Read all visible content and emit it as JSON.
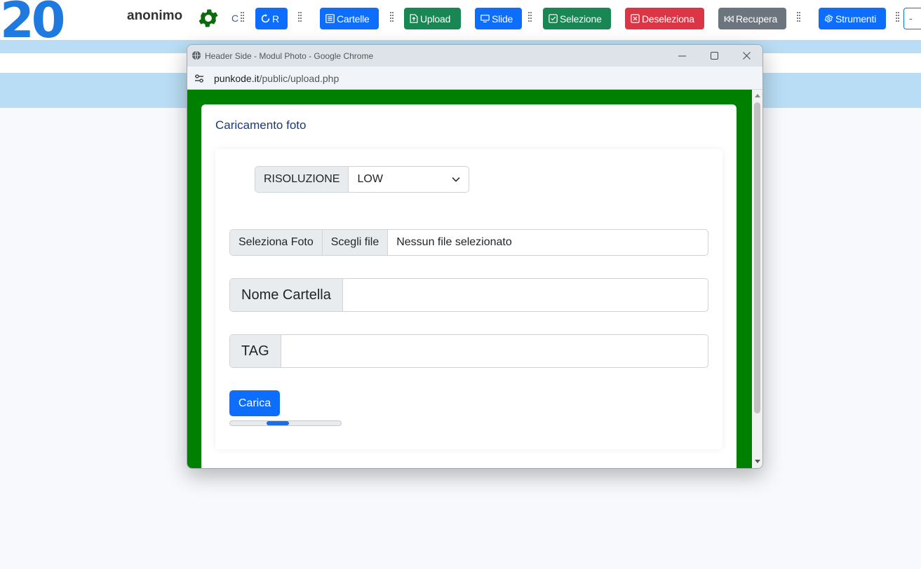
{
  "page": {
    "logo_text": "20",
    "username": "anonimo",
    "c_label": "C",
    "toolbar": {
      "refresh_label": "R",
      "cartelle_label": "Cartelle",
      "upload_label": "Upload",
      "slide_label": "Slide",
      "selezione_label": "Selezione",
      "deseleziona_label": "Deseleziona",
      "recupera_label": "Recupera",
      "strumenti_label": "Strumenti",
      "minus_label": "-"
    },
    "colors": {
      "primary": "#0d6efd",
      "success": "#198754",
      "danger": "#dc3545",
      "secondary": "#6c757d",
      "popup_bg": "#008000",
      "band": "#b9ddf4"
    }
  },
  "window": {
    "title": "Header Side - Modul Photo - Google Chrome",
    "url_host": "punkode.it",
    "url_path": "/public/upload.php"
  },
  "form": {
    "title": "Caricamento foto",
    "resolution_label": "RISOLUZIONE",
    "resolution_value": "LOW",
    "select_photo_label": "Seleziona Foto",
    "choose_file_label": "Scegli file",
    "no_file_text": "Nessun file selezionato",
    "folder_label": "Nome Cartella",
    "folder_value": "",
    "tag_label": "TAG",
    "tag_value": "",
    "submit_label": "Carica"
  }
}
